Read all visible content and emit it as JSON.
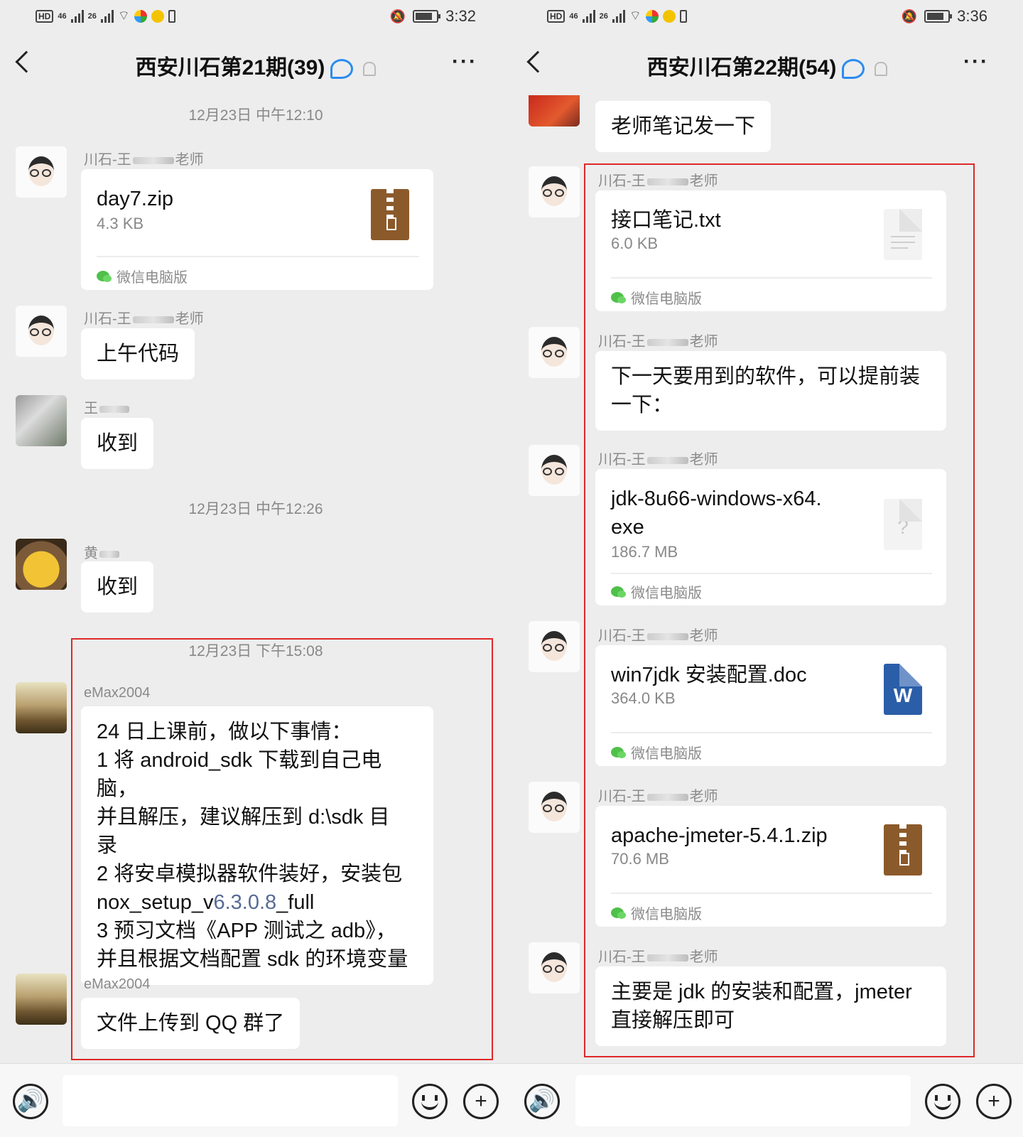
{
  "left": {
    "status": {
      "time": "3:32",
      "net1": "46",
      "net2": "26",
      "hd": "HD"
    },
    "title": "西安川石第21期(39)",
    "more": "···",
    "times": [
      "12月23日 中午12:10",
      "12月23日 中午12:26",
      "12月23日 下午15:08"
    ],
    "messages": [
      {
        "sender_pre": "川石-王",
        "sender_post": "老师",
        "file_name": "day7.zip",
        "file_size": "4.3 KB",
        "source": "微信电脑版"
      },
      {
        "sender_pre": "川石-王",
        "sender_post": "老师",
        "text": "上午代码"
      },
      {
        "sender_pre": "王",
        "sender_post": "",
        "text": "收到"
      },
      {
        "sender_pre": "黄",
        "sender_post": "",
        "text": "收到"
      },
      {
        "sender": "eMax2004",
        "lines": [
          "24 日上课前，做以下事情：",
          "1 将 android_sdk 下载到自己电脑，",
          "并且解压，建议解压到 d:\\sdk 目",
          "录",
          "2 将安卓模拟器软件装好，安装包"
        ],
        "line6_pre": "nox_setup_v",
        "line6_num": "6.3.0.8",
        "line6_post": "_full",
        "lines_end": [
          "3 预习文档《APP 测试之 adb》，",
          "并且根据文档配置 sdk 的环境变量"
        ]
      },
      {
        "sender": "eMax2004",
        "text": "文件上传到 QQ 群了"
      }
    ]
  },
  "right": {
    "status": {
      "time": "3:36",
      "net1": "46",
      "net2": "26",
      "hd": "HD"
    },
    "title": "西安川石第22期(54)",
    "more": "···",
    "messages": [
      {
        "text": "老师笔记发一下"
      },
      {
        "sender_pre": "川石-王",
        "sender_post": "老师",
        "file_name": "接口笔记.txt",
        "file_size": "6.0 KB",
        "source": "微信电脑版"
      },
      {
        "sender_pre": "川石-王",
        "sender_post": "老师",
        "lines": [
          "下一天要用到的软件，可以提前装",
          "一下："
        ]
      },
      {
        "sender_pre": "川石-王",
        "sender_post": "老师",
        "file_name_lines": [
          "jdk-8u66-windows-x64.",
          "exe"
        ],
        "file_size": "186.7 MB",
        "icon_text": "?",
        "source": "微信电脑版"
      },
      {
        "sender_pre": "川石-王",
        "sender_post": "老师",
        "file_name": "win7jdk 安装配置.doc",
        "file_size": "364.0 KB",
        "icon_text": "W",
        "source": "微信电脑版"
      },
      {
        "sender_pre": "川石-王",
        "sender_post": "老师",
        "file_name": "apache-jmeter-5.4.1.zip",
        "file_size": "70.6 MB",
        "source": "微信电脑版"
      },
      {
        "sender_pre": "川石-王",
        "sender_post": "老师",
        "lines": [
          "主要是 jdk 的安装和配置，jmeter",
          "直接解压即可"
        ]
      }
    ]
  },
  "input": {
    "voice_icon": "🔊",
    "plus": "+"
  }
}
